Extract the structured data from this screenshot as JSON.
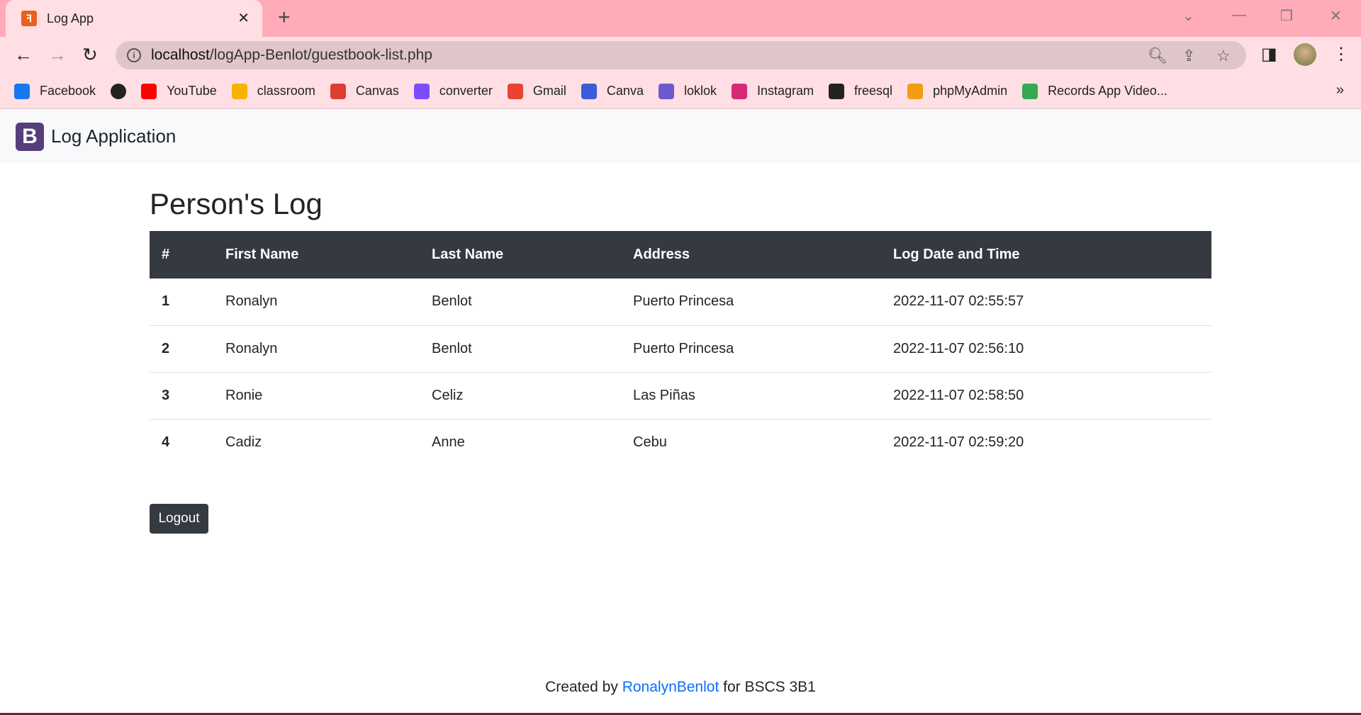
{
  "browser": {
    "tab_title": "Log App",
    "url_host": "localhost",
    "url_path": "/logApp-Benlot/guestbook-list.php",
    "bookmarks": [
      {
        "label": "Facebook",
        "color": "#1877f2"
      },
      {
        "label": "",
        "color": "#222222"
      },
      {
        "label": "YouTube",
        "color": "#ff0000"
      },
      {
        "label": "classroom",
        "color": "#f4b400"
      },
      {
        "label": "Canvas",
        "color": "#e03c31"
      },
      {
        "label": "converter",
        "color": "#7c4dff"
      },
      {
        "label": "Gmail",
        "color": "#ea4335"
      },
      {
        "label": "Canva",
        "color": "#3b5bdb"
      },
      {
        "label": "loklok",
        "color": "#6a5acd"
      },
      {
        "label": "Instagram",
        "color": "#d62976"
      },
      {
        "label": "freesql",
        "color": "#222222"
      },
      {
        "label": "phpMyAdmin",
        "color": "#f39c12"
      },
      {
        "label": "Records App Video...",
        "color": "#34a853"
      }
    ]
  },
  "navbar": {
    "logo_letter": "B",
    "brand": "Log Application"
  },
  "page": {
    "title": "Person's Log",
    "columns": [
      "#",
      "First Name",
      "Last Name",
      "Address",
      "Log Date and Time"
    ],
    "rows": [
      [
        "1",
        "Ronalyn",
        "Benlot",
        "Puerto Princesa",
        "2022-11-07 02:55:57"
      ],
      [
        "2",
        "Ronalyn",
        "Benlot",
        "Puerto Princesa",
        "2022-11-07 02:56:10"
      ],
      [
        "3",
        "Ronie",
        "Celiz",
        "Las Piñas",
        "2022-11-07 02:58:50"
      ],
      [
        "4",
        "Cadiz",
        "Anne",
        "Cebu",
        "2022-11-07 02:59:20"
      ]
    ],
    "logout_label": "Logout"
  },
  "footer": {
    "prefix": "Created by ",
    "link": "RonalynBenlot",
    "suffix": " for BSCS 3B1"
  }
}
